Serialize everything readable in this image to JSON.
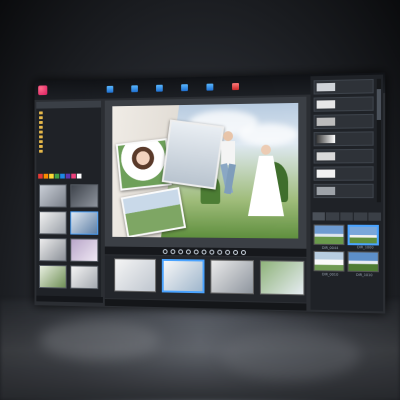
{
  "app": {
    "logo_text": ""
  },
  "toolbar": {
    "buttons": [
      {
        "label": "",
        "icon": "open-icon"
      },
      {
        "label": "",
        "icon": "save-icon"
      },
      {
        "label": "",
        "icon": "template-icon"
      },
      {
        "label": "",
        "icon": "export-icon"
      },
      {
        "label": "",
        "icon": "crop-icon"
      },
      {
        "label": "",
        "icon": "settings-icon"
      }
    ],
    "status_text": ""
  },
  "left_panel": {
    "header": "",
    "tree": [
      "",
      "",
      "",
      "",
      "",
      "",
      "",
      "",
      ""
    ],
    "palette_colors": [
      "#e53935",
      "#fb8c00",
      "#fdd835",
      "#43a047",
      "#1e88e5",
      "#5e35b1",
      "#ec407a",
      "#ffffff"
    ],
    "footer": ""
  },
  "canvas": {
    "script_title": ""
  },
  "filmstrip": {
    "items": [
      {
        "label": ""
      },
      {
        "label": ""
      },
      {
        "label": ""
      },
      {
        "label": ""
      }
    ],
    "status": ""
  },
  "right_panel": {
    "tabs": [
      "",
      "",
      "",
      "",
      ""
    ],
    "thumbs": [
      {
        "caption": "DIR_0044"
      },
      {
        "caption": "DIR_1000"
      },
      {
        "caption": "DIR_0010"
      },
      {
        "caption": "DIR_1010"
      }
    ]
  },
  "colors": {
    "accent": "#4aa3ff",
    "toolbar_bg": "#101216",
    "panel_bg": "#1f2227"
  }
}
